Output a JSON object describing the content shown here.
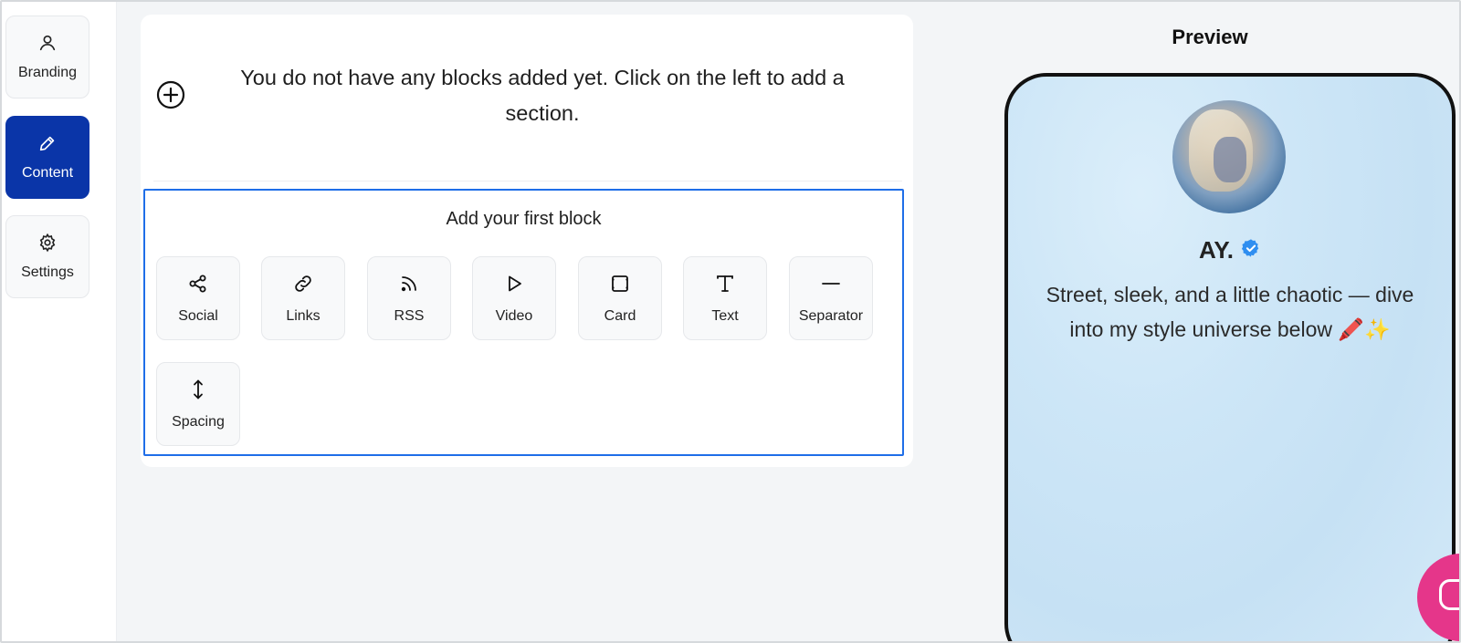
{
  "sidebar": {
    "items": [
      {
        "label": "Branding",
        "icon": "user-icon",
        "active": false
      },
      {
        "label": "Content",
        "icon": "pencil-icon",
        "active": true
      },
      {
        "label": "Settings",
        "icon": "gear-icon",
        "active": false
      }
    ]
  },
  "editor": {
    "empty_message": "You do not have any blocks added yet. Click on the left to add a section.",
    "blocks_title": "Add your first block",
    "blocks": [
      {
        "label": "Social",
        "icon": "share-icon"
      },
      {
        "label": "Links",
        "icon": "link-icon"
      },
      {
        "label": "RSS",
        "icon": "rss-icon"
      },
      {
        "label": "Video",
        "icon": "play-icon"
      },
      {
        "label": "Card",
        "icon": "card-icon"
      },
      {
        "label": "Text",
        "icon": "text-icon"
      },
      {
        "label": "Separator",
        "icon": "minus-icon"
      },
      {
        "label": "Spacing",
        "icon": "vertical-arrows-icon"
      }
    ]
  },
  "preview": {
    "title": "Preview",
    "profile_name": "AY.",
    "bio": "Street, sleek, and a little chaotic — dive into my style universe below 🖍️✨"
  },
  "colors": {
    "active_nav": "#0a35a8",
    "focus_border": "#1f6ee8",
    "verified": "#2f8ef0",
    "chat_button": "#e5368a"
  }
}
